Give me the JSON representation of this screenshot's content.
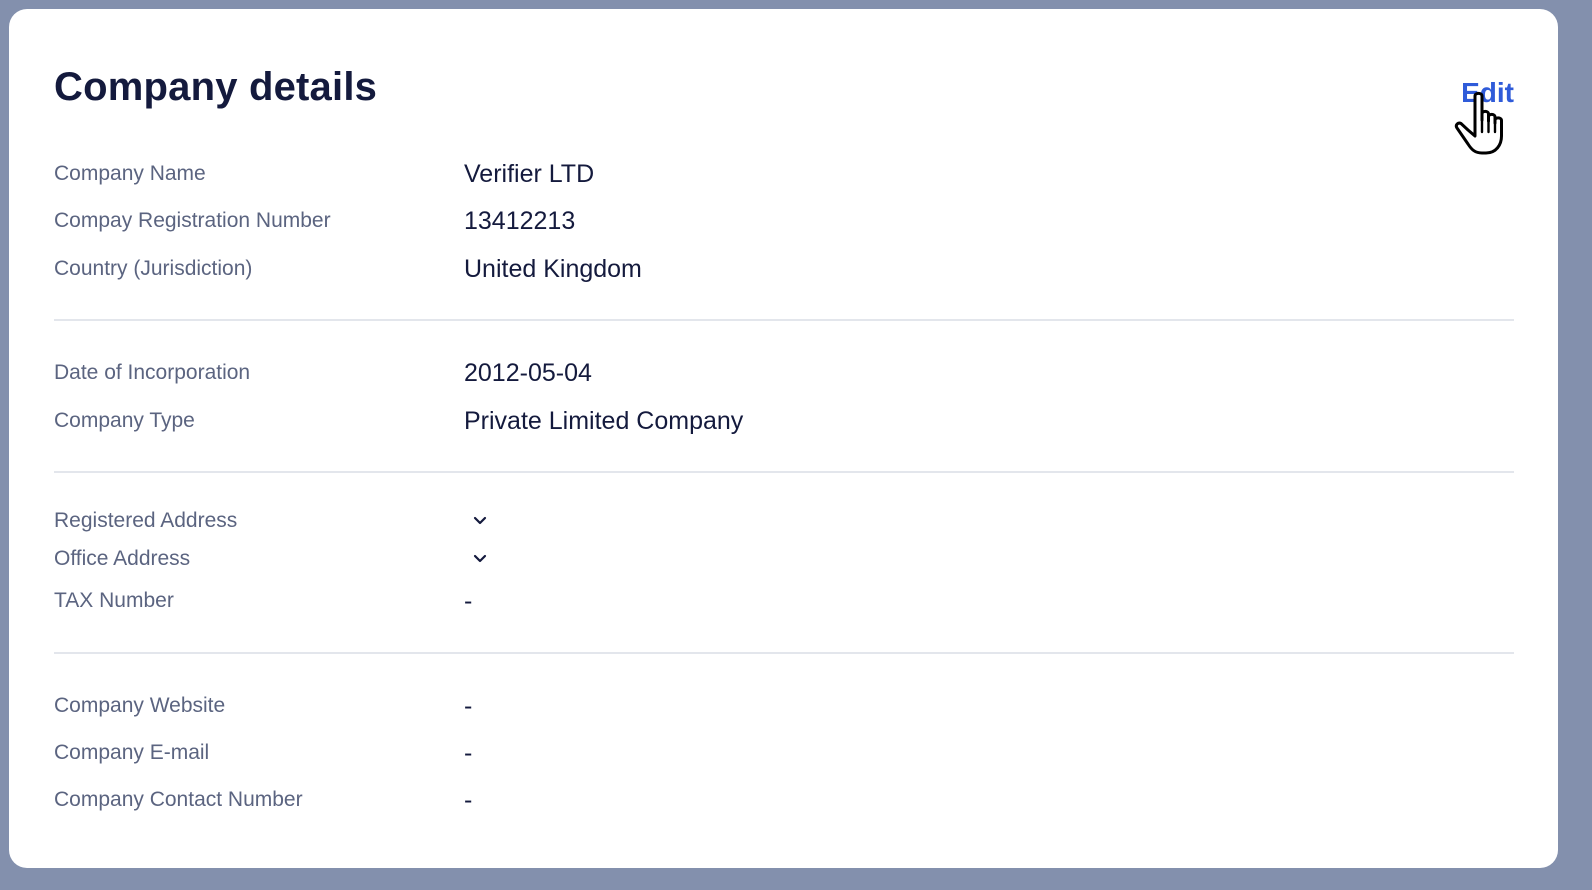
{
  "header": {
    "title": "Company details",
    "edit_label": "Edit"
  },
  "section1": {
    "company_name": {
      "label": "Company Name",
      "value": "Verifier LTD"
    },
    "registration_number": {
      "label": "Compay Registration Number",
      "value": "13412213"
    },
    "country": {
      "label": "Country (Jurisdiction)",
      "value": "United Kingdom"
    }
  },
  "section2": {
    "date_of_incorporation": {
      "label": "Date of Incorporation",
      "value": "2012-05-04"
    },
    "company_type": {
      "label": "Company Type",
      "value": "Private Limited Company"
    }
  },
  "section3": {
    "registered_address": {
      "label": "Registered Address",
      "icon": "chevron-down-icon"
    },
    "office_address": {
      "label": "Office Address",
      "icon": "chevron-down-icon"
    },
    "tax_number": {
      "label": "TAX Number",
      "value": "-"
    }
  },
  "section4": {
    "website": {
      "label": "Company Website",
      "value": "-"
    },
    "email": {
      "label": "Company E-mail",
      "value": "-"
    },
    "contact_number": {
      "label": "Company Contact Number",
      "value": "-"
    }
  },
  "colors": {
    "frame": "#8390ad",
    "title": "#141a3d",
    "label": "#5b6480",
    "accent": "#2f5bd9",
    "divider": "#e3e6ec"
  },
  "icons": {
    "cursor": "hand-pointer-cursor-icon"
  }
}
